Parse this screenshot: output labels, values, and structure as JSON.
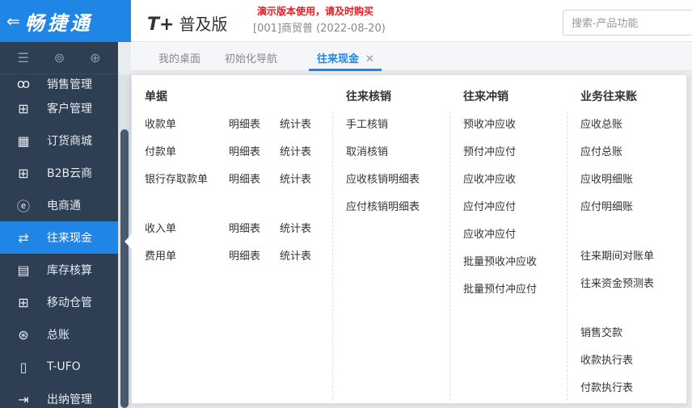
{
  "brand": {
    "back_icon": "back-arrow-icon",
    "name": "畅捷通"
  },
  "header": {
    "logo_mark": "T+",
    "edition": "普及版",
    "demo_warning": "演示版本使用，请及时购买",
    "company_info": "[001]商贸普   (2022-08-20)",
    "search_placeholder": "搜索-产品功能"
  },
  "tabs": [
    {
      "label": "我的桌面",
      "active": false
    },
    {
      "label": "初始化导航",
      "active": false
    },
    {
      "label": "往来现金",
      "active": true,
      "close": "✕"
    }
  ],
  "sidebar": {
    "tools": [
      "menu-icon",
      "search-doc-icon",
      "add-doc-icon"
    ],
    "items": [
      {
        "label": "销售管理",
        "icon": "sales-icon",
        "glyph": "ꝏ"
      },
      {
        "label": "客户管理",
        "icon": "grid-plus-icon",
        "glyph": "⊞"
      },
      {
        "label": "订货商城",
        "icon": "store-icon",
        "glyph": "▦"
      },
      {
        "label": "B2B云商",
        "icon": "grid-plus-icon",
        "glyph": "⊞"
      },
      {
        "label": "电商通",
        "icon": "ecommerce-icon",
        "glyph": "ⓔ"
      },
      {
        "label": "往来现金",
        "icon": "exchange-icon",
        "glyph": "⇄"
      },
      {
        "label": "库存核算",
        "icon": "inventory-icon",
        "glyph": "▤"
      },
      {
        "label": "移动仓管",
        "icon": "grid-plus-icon",
        "glyph": "⊞"
      },
      {
        "label": "总账",
        "icon": "ledger-icon",
        "glyph": "⊛"
      },
      {
        "label": "T-UFO",
        "icon": "ufo-icon",
        "glyph": "▯"
      },
      {
        "label": "出纳管理",
        "icon": "cashier-icon",
        "glyph": "⇥"
      }
    ]
  },
  "panel": {
    "columns": [
      {
        "title": "单据",
        "rows": [
          {
            "main": "收款单",
            "detail": "明细表",
            "stats": "统计表"
          },
          {
            "main": "付款单",
            "detail": "明细表",
            "stats": "统计表"
          },
          {
            "main": "银行存取款单",
            "detail": "明细表",
            "stats": "统计表"
          },
          {
            "main": "收入单",
            "detail": "明细表",
            "stats": "统计表"
          },
          {
            "main": "费用单",
            "detail": "明细表",
            "stats": "统计表"
          }
        ]
      },
      {
        "title": "往来核销",
        "items": [
          "手工核销",
          "取消核销",
          "应收核销明细表",
          "应付核销明细表"
        ]
      },
      {
        "title": "往来冲销",
        "items": [
          "预收冲应收",
          "预付冲应付",
          "应收冲应收",
          "应付冲应付",
          "应收冲应付",
          "批量预收冲应收",
          "批量预付冲应付"
        ]
      },
      {
        "title": "业务往来账",
        "items": [
          "应收总账",
          "应付总账",
          "应收明细账",
          "应付明细账",
          "往来期间对账单",
          "往来资金预测表",
          "销售交款",
          "收款执行表",
          "付款执行表"
        ]
      }
    ]
  }
}
